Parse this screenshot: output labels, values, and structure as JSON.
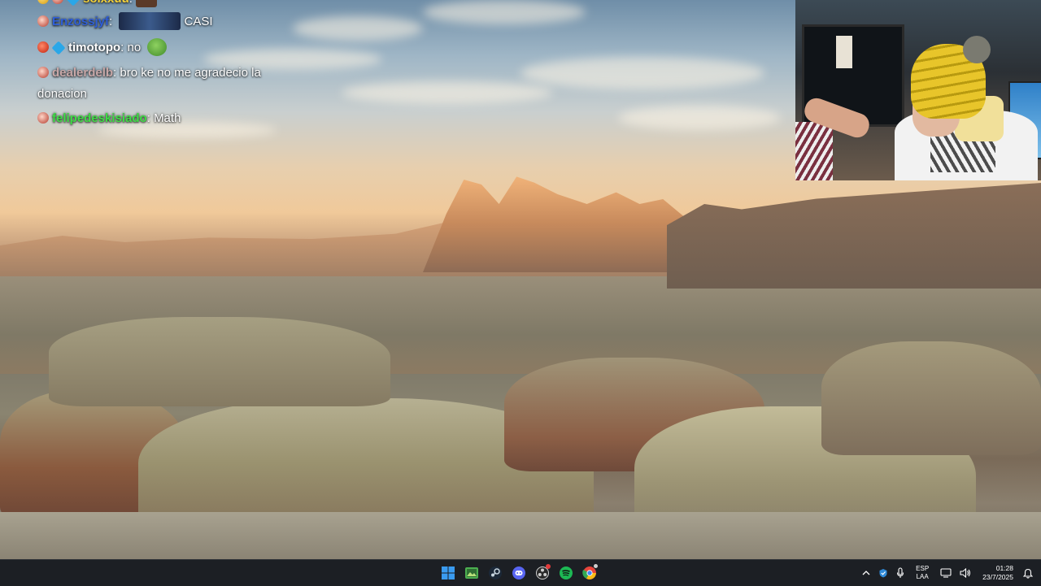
{
  "chat": {
    "messages": [
      {
        "user": "solxxuu",
        "user_color": "#f6d33a",
        "separator": ":",
        "text": "",
        "badges": [
          "gold",
          "sub",
          "prime"
        ],
        "emote": "small"
      },
      {
        "user": "Enzossjyf",
        "user_color": "#2f5fd8",
        "separator": ":",
        "text": "CASI",
        "badges": [
          "sub"
        ],
        "emote": "cars"
      },
      {
        "user": "timotopo",
        "user_color": "#ffffff",
        "separator": ":",
        "text": "no",
        "badges": [
          "red",
          "prime"
        ],
        "emote": "pepe"
      },
      {
        "user": "dealerdelb",
        "user_color": "#c8a8a8",
        "separator": ":",
        "text": "bro ke no me agradecio la",
        "continuation": "donacion",
        "badges": [
          "sub"
        ],
        "emote": ""
      },
      {
        "user": "felipedeskisiado",
        "user_color": "#3fdc46",
        "separator": ":",
        "text": "Math",
        "badges": [
          "sub"
        ],
        "emote": ""
      }
    ]
  },
  "taskbar": {
    "apps": [
      {
        "name": "windows-start-icon",
        "color": "#3a9bf0"
      },
      {
        "name": "photos-app-icon",
        "color": "#4caf50"
      },
      {
        "name": "steam-icon",
        "color": "#c7d5e0"
      },
      {
        "name": "discord-icon",
        "color": "#5865f2"
      },
      {
        "name": "obs-icon",
        "color": "#d0d0d0"
      },
      {
        "name": "spotify-icon",
        "color": "#1db954"
      },
      {
        "name": "chrome-icon",
        "color": "#e8453c"
      }
    ],
    "tray": {
      "lang_top": "ESP",
      "lang_bottom": "LAA",
      "time": "01:28",
      "date": "23/7/2025"
    }
  }
}
